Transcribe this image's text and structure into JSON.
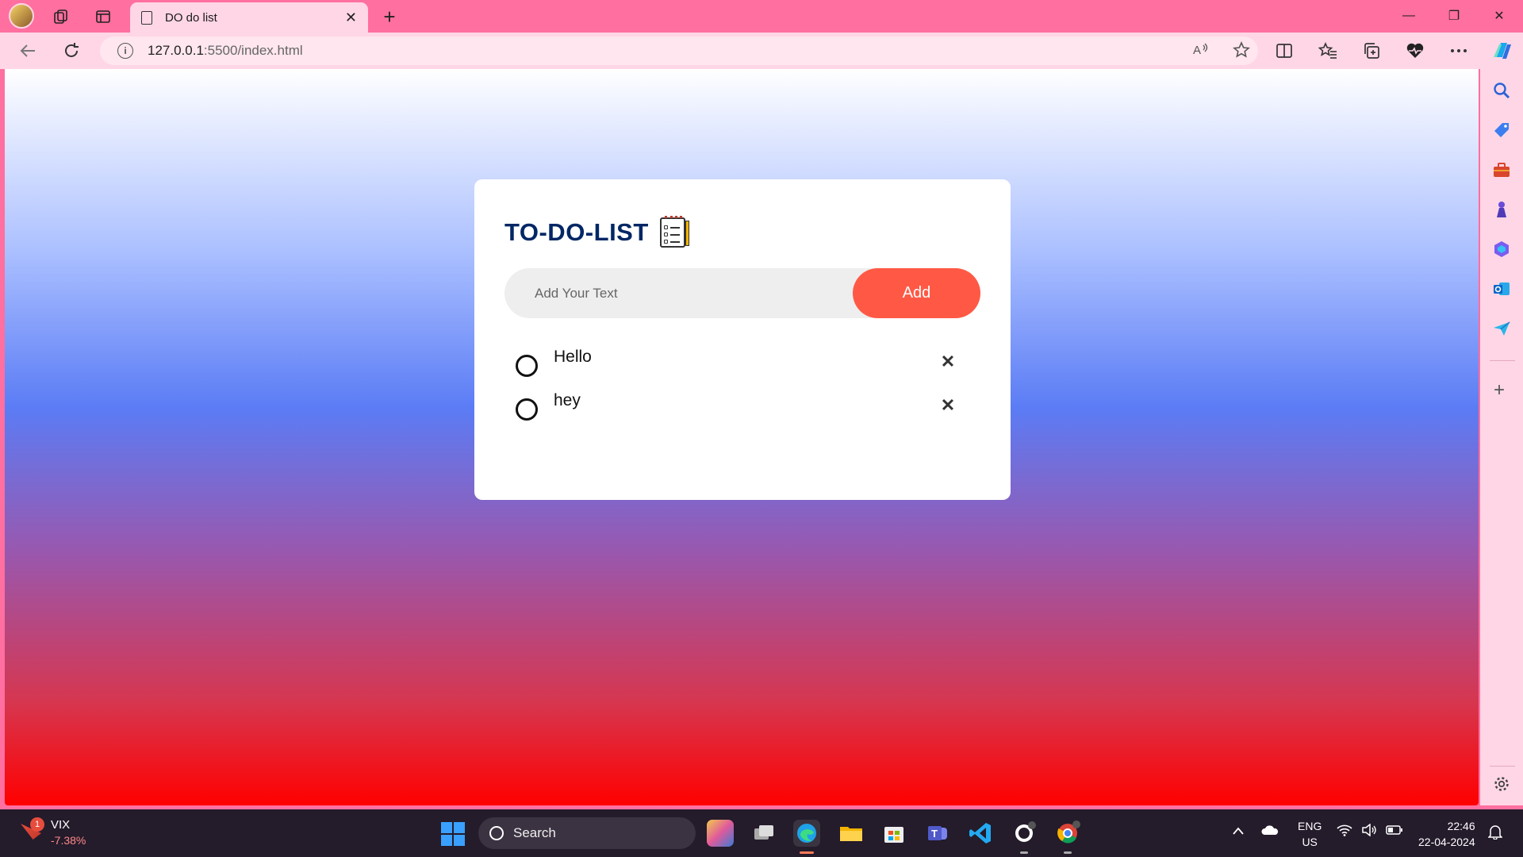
{
  "browser": {
    "tab_title": "DO do list",
    "tab_close": "✕",
    "new_tab": "+",
    "url_host": "127.0.0.1",
    "url_rest": ":5500/index.html",
    "win_minimize": "—",
    "win_restore": "❐",
    "win_close": "✕"
  },
  "app": {
    "heading": "TO-DO-LIST",
    "input_placeholder": "Add Your Text",
    "add_label": "Add",
    "tasks": [
      {
        "text": "Hello",
        "remove": "✕"
      },
      {
        "text": "hey",
        "remove": "✕"
      }
    ]
  },
  "taskbar": {
    "widget_name": "VIX",
    "widget_value": "-7.38%",
    "widget_badge": "1",
    "search_label": "Search",
    "lang_primary": "ENG",
    "lang_secondary": "US",
    "time": "22:46",
    "date": "22-04-2024"
  },
  "colors": {
    "heading": "#002765",
    "add_button": "#ff5945",
    "chrome": "#ff6fa0",
    "toolbar": "#ffd6e6"
  },
  "icons": {
    "tab_page": "page-icon",
    "info": "info-icon",
    "read_aloud": "read-aloud-icon",
    "favorite": "star-icon",
    "split": "split-screen-icon",
    "favorites": "favorites-icon",
    "collections": "collections-icon",
    "health": "heart-icon",
    "more": "more-icon",
    "copilot": "copilot-icon"
  }
}
